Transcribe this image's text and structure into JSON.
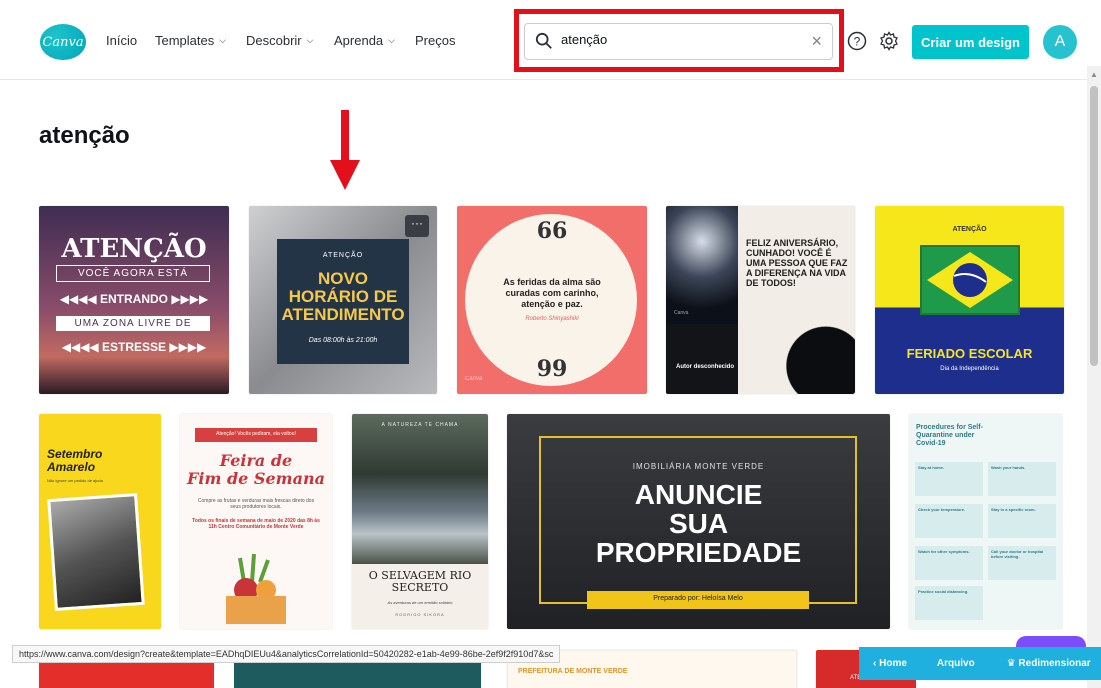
{
  "header": {
    "logo_text": "Canva",
    "nav": [
      {
        "label": "Início",
        "has_chevron": false
      },
      {
        "label": "Templates",
        "has_chevron": true
      },
      {
        "label": "Descobrir",
        "has_chevron": true
      },
      {
        "label": "Aprenda",
        "has_chevron": true
      },
      {
        "label": "Preços",
        "has_chevron": false
      }
    ],
    "chevron": "⌵",
    "search_value": "atenção",
    "help_icon": "?",
    "create_button": "Criar um design",
    "avatar_letter": "A"
  },
  "page_title": "atenção",
  "row1": {
    "c1": {
      "title": "ATENÇÃO",
      "line1": "VOCÊ AGORA ESTÁ",
      "line2": "◀◀◀◀ ENTRANDO ▶▶▶▶",
      "line3": "UMA ZONA LIVRE DE",
      "line4": "◀◀◀◀ ESTRESSE ▶▶▶▶"
    },
    "c2": {
      "small": "ATENÇÃO",
      "big1": "NOVO",
      "big2": "HORÁRIO DE",
      "big3": "ATENDIMENTO",
      "hours": "Das 08:00h às 21:00h",
      "more": "···"
    },
    "c3": {
      "quote_open": "66",
      "quote": "As feridas da alma são curadas com carinho, atenção e paz.",
      "author": "Roberto Shinyashiki",
      "quote_close": "99",
      "brand": "Canva"
    },
    "c4": {
      "text": "FELIZ ANIVERSÁRIO, CUNHADO! VOCÊ É UMA PESSOA QUE FAZ A DIFERENÇA NA VIDA DE TODOS!",
      "author": "Autor desconhecido",
      "brand": "Canva"
    },
    "c5": {
      "small": "ATENÇÃO",
      "title": "FERIADO ESCOLAR",
      "subtitle": "Dia da Independência"
    }
  },
  "row2": {
    "c6": {
      "title": "Setembro Amarelo",
      "sub": "Não ignore um pedido de ajuda"
    },
    "c7": {
      "banner": "Atenção! Vocês pediram, ela voltou!",
      "title1": "Feira de",
      "title2": "Fim de Semana",
      "body": "Compre as frutas e verduras mais frescas direto dos seus produtores locais.",
      "details": "Todos os finais de semana de maio de 2020 das 8h às 11h Centro Comunitário de Monte Verde"
    },
    "c8": {
      "small": "A NATUREZA TE CHAMA",
      "title": "O SELVAGEM RIO SECRETO",
      "sub": "As aventuras de um ermitão solitário",
      "author": "RODRIGO SIKORA"
    },
    "c9": {
      "brand": "IMOBILIÁRIA MONTE VERDE",
      "big1": "ANUNCIE",
      "big2": "SUA",
      "big3": "PROPRIEDADE",
      "footer": "Preparado por: Heloísa Melo"
    },
    "c10": {
      "title": "Procedures for Self-Quarantine under Covid-19",
      "items": [
        "Stay at home.",
        "Wash your hands.",
        "Check your temperature.",
        "Stay in a specific room.",
        "Watch for other symptoms.",
        "Call your doctor or hospital before visiting.",
        "Practice social distancing."
      ]
    }
  },
  "row3": {
    "c13": "PREFEITURA DE MONTE VERDE",
    "c14": "ATE"
  },
  "status_url": "https://www.canva.com/design?create&template=EADhqDIEUu4&analyticsCorrelationId=50420282-e1ab-4e99-86be-2ef9f2f910d7&sc",
  "editor_bar": {
    "back": "‹  Home",
    "file": "Arquivo",
    "resize": "♛  Redimensionar"
  },
  "colors": {
    "accent": "#00c4cc",
    "highlight": "#e3101b",
    "arrow": "#e3101b"
  }
}
